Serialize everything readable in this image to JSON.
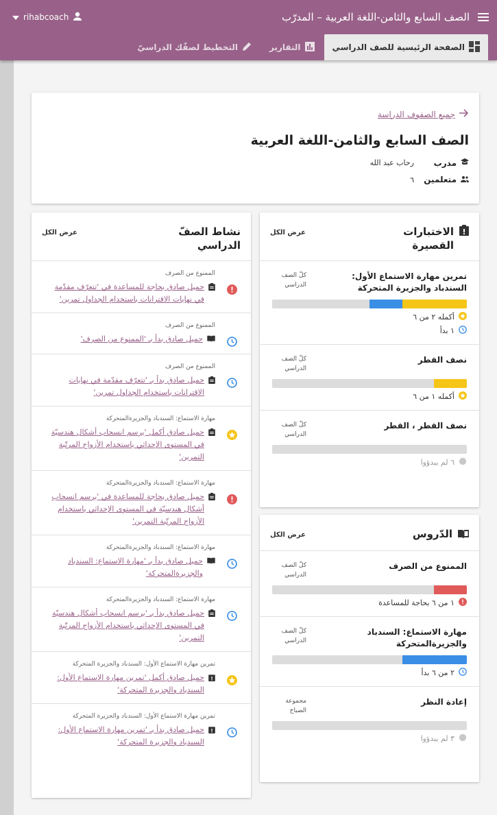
{
  "app_bar": {
    "title": "الصف السابع والثامن-اللغة العربية – المدرّب",
    "username": "rihabcoach"
  },
  "tabs": [
    {
      "label": "الصفحة الرئيسية للصف الدراسي",
      "active": true
    },
    {
      "label": "التقارير",
      "active": false
    },
    {
      "label": "التخطيط لصفّك الدراسيّ",
      "active": false
    }
  ],
  "header": {
    "back_link": "جميع الصفوف الدراسة",
    "class_title": "الصف السابع والثامن-اللغة العربية",
    "coach_label": "مدرب",
    "coach_value": "رحاب عبد الله",
    "learners_label": "متعلمين",
    "learners_value": "٦"
  },
  "quizzes": {
    "title": "الاختبارات القصيرة",
    "view_all": "عرض الكل",
    "items": [
      {
        "name": "تمرين مهارة الاستماع الأول: السندباد والجزيرة المتحركة",
        "scope": "كلّ الصف الدراسي",
        "completed": 0.33,
        "started": 0.17,
        "stats": [
          {
            "icon": "star",
            "text": "أكمله ٢ من ٦"
          },
          {
            "icon": "clock",
            "text": "١ بدأ"
          }
        ]
      },
      {
        "name": "نصف القطر",
        "scope": "كلّ الصف الدراسي",
        "completed": 0.17,
        "started": 0,
        "stats": [
          {
            "icon": "star",
            "text": "أكمله ١ من ٦"
          }
        ]
      },
      {
        "name": "نصف القطر ، القطر",
        "scope": "كلّ الصف الدراسي",
        "completed": 0,
        "started": 0,
        "stats": [
          {
            "icon": "dot",
            "text": "٦ لم يبدؤوا"
          }
        ]
      }
    ]
  },
  "lessons": {
    "title": "الدّروس",
    "view_all": "عرض الكل",
    "items": [
      {
        "name": "الممنوع من الصرف",
        "scope": "كلّ الصف الدراسي",
        "help": 0.17,
        "started": 0,
        "stats": [
          {
            "icon": "alert",
            "text": "١ من ٦ بحاجة للمساعدة"
          }
        ]
      },
      {
        "name": "مهارة الاستماع: السندباد والجزيرةالمتحركة",
        "scope": "كلّ الصف الدراسي",
        "help": 0,
        "started": 0.33,
        "stats": [
          {
            "icon": "clock",
            "text": "٢ من ٦ بدأ"
          }
        ]
      },
      {
        "name": "إعادة النظر",
        "scope": "مجموعة الصباح",
        "help": 0,
        "started": 0,
        "stats": [
          {
            "icon": "dot",
            "text": "٣ لم يبدؤوا"
          }
        ]
      }
    ]
  },
  "activity": {
    "title": "نشاط الصفّ الدراسي",
    "view_all": "عرض الكل",
    "items": [
      {
        "status": "alert",
        "meta": "الممنوع من الصرف",
        "kind": "quiz",
        "text": "حميل صادق بحاجة للمساعدة في 'تتعرّف مقدّمة في نهايات الاقترانات باستخدام الجداول تمرين'"
      },
      {
        "status": "clock",
        "meta": "الممنوع من الصرف",
        "kind": "lesson",
        "text": "حميل صادق بدأ بـ 'الممنوع من الصرف'"
      },
      {
        "status": "clock",
        "meta": "الممنوع من الصرف",
        "kind": "quiz",
        "text": "حميل صادق بدأ بـ 'تتعرّف مقدّمة في نهايات الاقترانات باستخدام الجداول تمرين'"
      },
      {
        "status": "star",
        "meta": "مهارة الاستماع: السندباد والجزيرةالمتحركة",
        "kind": "quiz",
        "text": "حميل صادق أكمل 'يرسم انسحاب أشكال هندسيّة في المستوى الإحداثي باستخدام الأزواج المرتّبة التمرين'"
      },
      {
        "status": "alert",
        "meta": "مهارة الاستماع: السندباد والجزيرةالمتحركة",
        "kind": "quiz",
        "text": "حميل صادق بحاجة للمساعدة في 'يرسم انسحاب أشكال هندسيّة في المستوى الإحداثي باستخدام الأزواج المرتّبة التمرين'"
      },
      {
        "status": "clock",
        "meta": "مهارة الاستماع: السندباد والجزيرةالمتحركة",
        "kind": "lesson",
        "text": "حميل صادق بدأ بـ 'مهارة الاستماع: السندباد والجزيرةالمتحركة'"
      },
      {
        "status": "clock",
        "meta": "مهارة الاستماع: السندباد والجزيرةالمتحركة",
        "kind": "quiz",
        "text": "حميل صادق بدأ بـ 'يرسم انسحاب أشكال هندسيّة في المستوى الإحداثي باستخدام الأزواج المرتّبة التمرين'"
      },
      {
        "status": "star",
        "meta": "تمرين مهارة الاستماع الأول: السندباد والجزيرة المتحركة",
        "kind": "exam",
        "text": "حميل صادق أكمل 'تمرين مهارة الاستماع الأول: السندباد والجزيرة المتحركة'"
      },
      {
        "status": "clock",
        "meta": "تمرين مهارة الاستماع الأول: السندباد والجزيرة المتحركة",
        "kind": "exam",
        "text": "حميل صادق بدأ بـ 'تمرين مهارة الاستماع الأول: السندباد والجزيرة المتحركة'"
      }
    ]
  },
  "colors": {
    "brand": "#996189",
    "star": "#f5c518",
    "clock": "#3a8ee6",
    "alert": "#e05a5a",
    "grey": "#c8c8c8"
  }
}
